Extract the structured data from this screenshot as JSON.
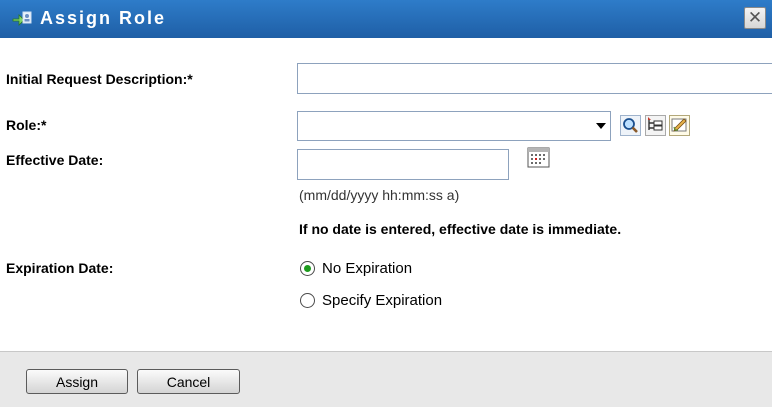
{
  "dialog": {
    "title": "Assign Role",
    "close_glyph": "✕",
    "title_icon": "assign-role-icon"
  },
  "form": {
    "description_label": "Initial Request Description:*",
    "description_value": "",
    "role_label": "Role:*",
    "role_value": "",
    "role_icons": [
      "search-icon",
      "hierarchy-icon",
      "edit-icon"
    ],
    "effective_date_label": "Effective Date:",
    "effective_date_value": "",
    "date_format_hint": "(mm/dd/yyyy hh:mm:ss a)",
    "effective_date_notice": "If no date is entered, effective date is immediate.",
    "expiration_date_label": "Expiration Date:",
    "expiration_options": [
      {
        "label": "No Expiration",
        "checked": true
      },
      {
        "label": "Specify Expiration",
        "checked": false
      }
    ]
  },
  "footer": {
    "assign_label": "Assign",
    "cancel_label": "Cancel"
  },
  "colors": {
    "titlebar": "#1f5fa6",
    "radio_selected": "#1c9a1c"
  }
}
